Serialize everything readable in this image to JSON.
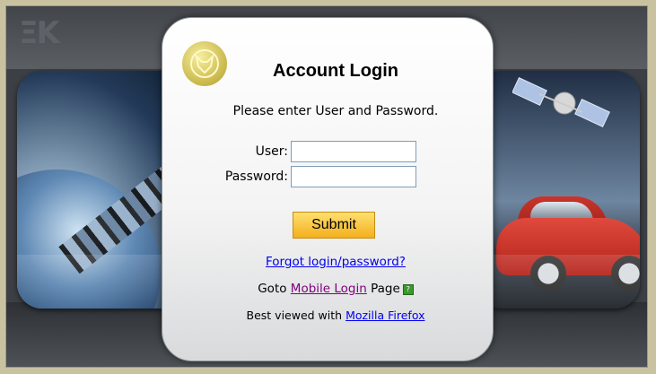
{
  "login": {
    "title": "Account Login",
    "subtitle": "Please enter User and Password.",
    "user_label": "User:",
    "user_value": "",
    "password_label": "Password:",
    "password_value": "",
    "submit_label": "Submit",
    "forgot_link": "Forgot login/password?",
    "goto_prefix": "Goto",
    "mobile_link": "Mobile Login",
    "goto_suffix": "Page",
    "best_viewed_prefix": "Best viewed with",
    "firefox_link": "Mozilla Firefox"
  },
  "icons": {
    "emblem": "fox-emblem-icon",
    "help": "help-icon"
  },
  "colors": {
    "link": "#0000ee",
    "visited_link": "#800080",
    "button_top": "#fde070",
    "button_bottom": "#f4b01c",
    "frame_border": "#c9c2a0"
  }
}
